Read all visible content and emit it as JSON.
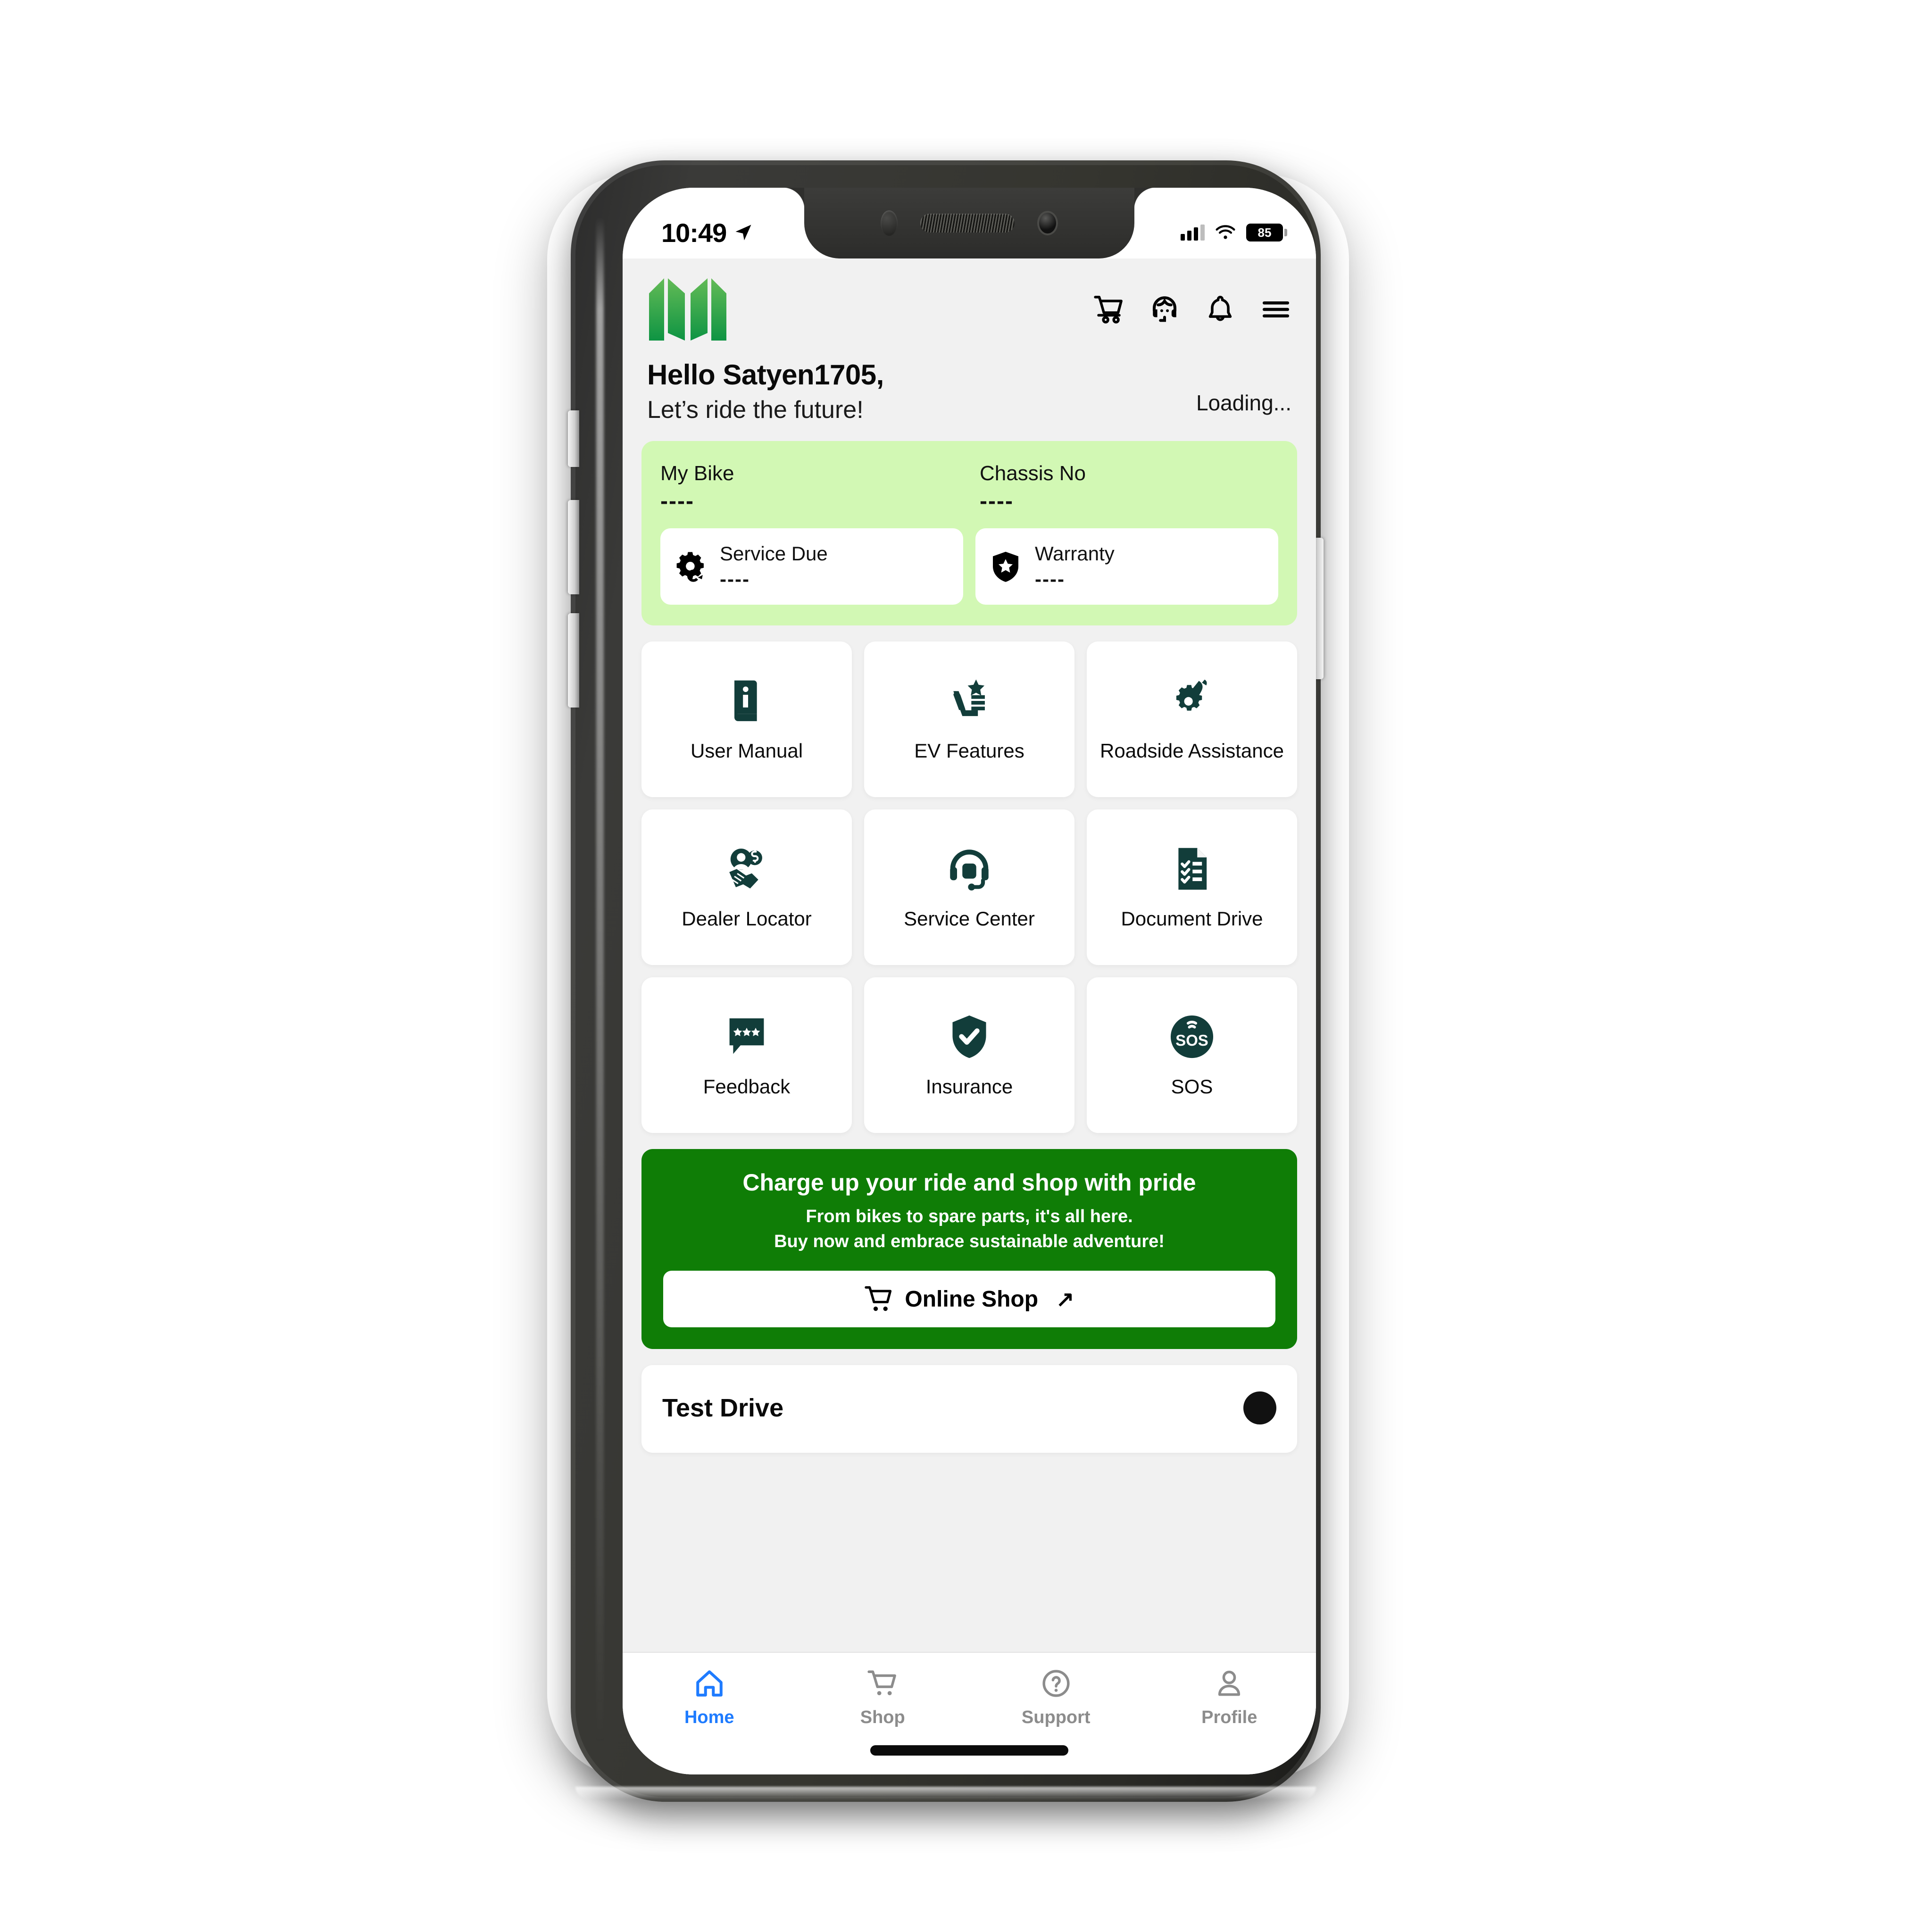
{
  "status_bar": {
    "time": "10:49",
    "location_icon": "location-arrow-icon",
    "signal_icon": "cellular-signal-icon",
    "wifi_icon": "wifi-icon",
    "battery_percent": "85"
  },
  "header": {
    "logo_name": "brand-logo",
    "icons": [
      {
        "name": "cart-icon",
        "label": "Cart"
      },
      {
        "name": "support-agent-icon",
        "label": "Support"
      },
      {
        "name": "bell-icon",
        "label": "Notifications"
      },
      {
        "name": "hamburger-menu-icon",
        "label": "Menu"
      }
    ]
  },
  "greeting": {
    "title": "Hello Satyen1705,",
    "subtitle": "Let’s ride the future!",
    "status": "Loading..."
  },
  "bike_card": {
    "my_bike_label": "My Bike",
    "my_bike_value": "----",
    "chassis_label": "Chassis No",
    "chassis_value": "----",
    "service_due_label": "Service Due",
    "service_due_value": "----",
    "service_due_icon": "gear-refresh-icon",
    "warranty_label": "Warranty",
    "warranty_value": "----",
    "warranty_icon": "shield-star-icon"
  },
  "tiles": [
    {
      "label": "User Manual",
      "icon": "info-book-icon"
    },
    {
      "label": "EV Features",
      "icon": "seat-star-icon"
    },
    {
      "label": "Roadside Assistance",
      "icon": "phone-gear-icon"
    },
    {
      "label": "Dealer Locator",
      "icon": "handshake-dollar-icon"
    },
    {
      "label": "Service Center",
      "icon": "headset-icon"
    },
    {
      "label": "Document Drive",
      "icon": "document-checklist-icon"
    },
    {
      "label": "Feedback",
      "icon": "chat-stars-icon"
    },
    {
      "label": "Insurance",
      "icon": "shield-check-icon"
    },
    {
      "label": "SOS",
      "icon": "sos-icon"
    }
  ],
  "promo_banner": {
    "title": "Charge up your ride and shop with pride",
    "line1": "From bikes to spare parts, it's all here.",
    "line2": "Buy now and embrace sustainable adventure!",
    "button_label": "Online Shop",
    "button_icon": "cart-icon",
    "button_arrow": "↗"
  },
  "test_drive": {
    "title": "Test Drive"
  },
  "bottom_nav": [
    {
      "label": "Home",
      "icon": "home-icon",
      "active": true
    },
    {
      "label": "Shop",
      "icon": "cart-icon",
      "active": false
    },
    {
      "label": "Support",
      "icon": "help-circle-icon",
      "active": false
    },
    {
      "label": "Profile",
      "icon": "user-icon",
      "active": false
    }
  ],
  "colors": {
    "brand_green_light": "#D2F8B4",
    "brand_green_dark": "#0F7D06",
    "icon_teal": "#123D3A",
    "nav_active": "#1E7BFF",
    "nav_inactive": "#8C8C8C",
    "app_bg": "#F1F1F1"
  }
}
